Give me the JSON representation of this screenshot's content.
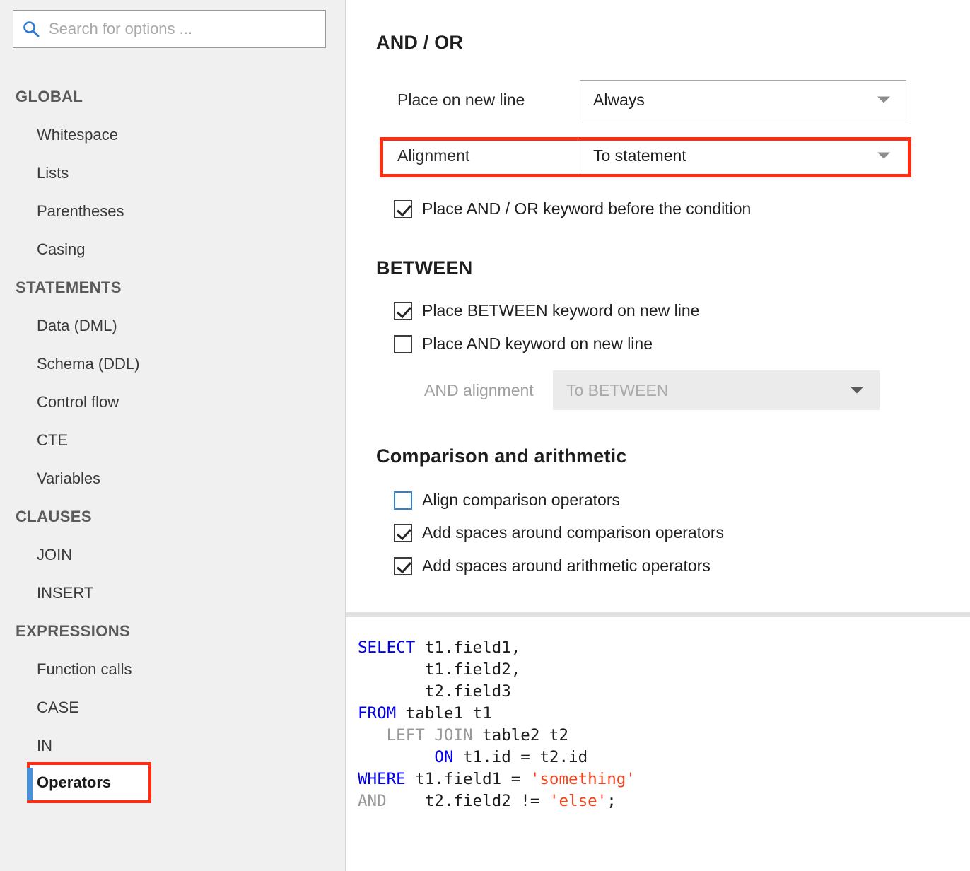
{
  "search": {
    "placeholder": "Search for options ...",
    "value": "",
    "icon": "search-icon"
  },
  "sidebar": {
    "groups": [
      {
        "title": "GLOBAL",
        "items": [
          {
            "label": "Whitespace",
            "selected": false,
            "highlighted": false
          },
          {
            "label": "Lists",
            "selected": false,
            "highlighted": false
          },
          {
            "label": "Parentheses",
            "selected": false,
            "highlighted": false
          },
          {
            "label": "Casing",
            "selected": false,
            "highlighted": false
          }
        ]
      },
      {
        "title": "STATEMENTS",
        "items": [
          {
            "label": "Data (DML)",
            "selected": false,
            "highlighted": false
          },
          {
            "label": "Schema (DDL)",
            "selected": false,
            "highlighted": false
          },
          {
            "label": "Control flow",
            "selected": false,
            "highlighted": false
          },
          {
            "label": "CTE",
            "selected": false,
            "highlighted": false
          },
          {
            "label": "Variables",
            "selected": false,
            "highlighted": false
          }
        ]
      },
      {
        "title": "CLAUSES",
        "items": [
          {
            "label": "JOIN",
            "selected": false,
            "highlighted": false
          },
          {
            "label": "INSERT",
            "selected": false,
            "highlighted": false
          }
        ]
      },
      {
        "title": "EXPRESSIONS",
        "items": [
          {
            "label": "Function calls",
            "selected": false,
            "highlighted": false
          },
          {
            "label": "CASE",
            "selected": false,
            "highlighted": false
          },
          {
            "label": "IN",
            "selected": false,
            "highlighted": false
          },
          {
            "label": "Operators",
            "selected": true,
            "highlighted": true
          }
        ]
      }
    ]
  },
  "options": {
    "and_or": {
      "title": "AND / OR",
      "place_on_new_line": {
        "label": "Place on new line",
        "value": "Always"
      },
      "alignment": {
        "label": "Alignment",
        "value": "To statement",
        "highlighted": true
      },
      "keyword_before_condition": {
        "label": "Place AND / OR keyword before the condition",
        "checked": true
      }
    },
    "between": {
      "title": "BETWEEN",
      "between_keyword_new_line": {
        "label": "Place BETWEEN keyword on new line",
        "checked": true
      },
      "and_keyword_new_line": {
        "label": "Place AND keyword on new line",
        "checked": false
      },
      "and_alignment": {
        "label": "AND alignment",
        "value": "To BETWEEN",
        "disabled": true
      }
    },
    "comparison": {
      "title": "Comparison and arithmetic",
      "align_comparison": {
        "label": "Align comparison operators",
        "checked": false
      },
      "spaces_comparison": {
        "label": "Add spaces around comparison operators",
        "checked": true
      },
      "spaces_arithmetic": {
        "label": "Add spaces around arithmetic operators",
        "checked": true
      }
    }
  },
  "preview": {
    "lines": [
      {
        "tokens": [
          {
            "t": "SELECT",
            "c": "kw"
          },
          {
            "t": " t1.field1,",
            "c": ""
          }
        ]
      },
      {
        "tokens": [
          {
            "t": "       t1.field2,",
            "c": ""
          }
        ]
      },
      {
        "tokens": [
          {
            "t": "       t2.field3",
            "c": ""
          }
        ]
      },
      {
        "tokens": [
          {
            "t": "FROM",
            "c": "kw"
          },
          {
            "t": " table1 t1",
            "c": ""
          }
        ]
      },
      {
        "tokens": [
          {
            "t": "   ",
            "c": ""
          },
          {
            "t": "LEFT JOIN",
            "c": "kwg"
          },
          {
            "t": " table2 t2",
            "c": ""
          }
        ]
      },
      {
        "tokens": [
          {
            "t": "        ",
            "c": ""
          },
          {
            "t": "ON",
            "c": "kw"
          },
          {
            "t": " t1.id = t2.id",
            "c": ""
          }
        ]
      },
      {
        "tokens": [
          {
            "t": "WHERE",
            "c": "kw"
          },
          {
            "t": " t1.field1 = ",
            "c": ""
          },
          {
            "t": "'something'",
            "c": "str"
          }
        ]
      },
      {
        "tokens": [
          {
            "t": "AND",
            "c": "kwg"
          },
          {
            "t": "    t2.field2 != ",
            "c": ""
          },
          {
            "t": "'else'",
            "c": "str"
          },
          {
            "t": ";",
            "c": ""
          }
        ]
      }
    ]
  },
  "colors": {
    "accent_blue": "#2b7cd3",
    "highlight_red": "#fb2e13",
    "sidebar_bg": "#f0f0f0",
    "keyword_blue": "#0000ee",
    "keyword_gray": "#999999",
    "string_orange": "#f4431c"
  }
}
